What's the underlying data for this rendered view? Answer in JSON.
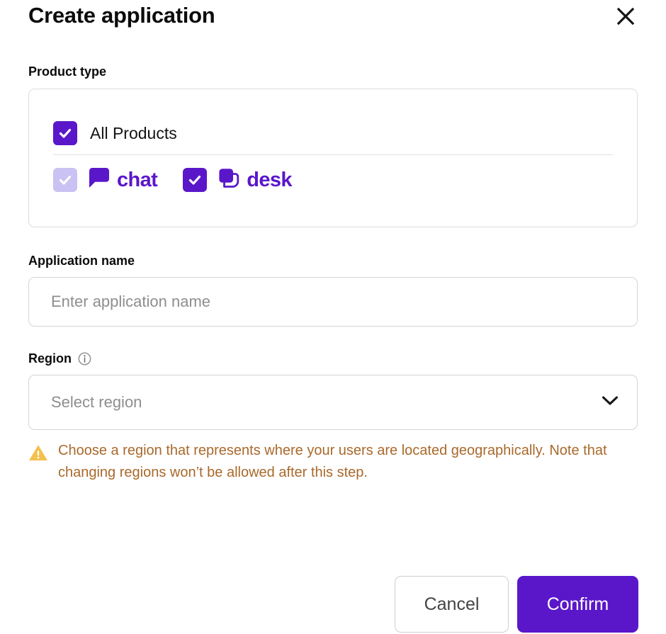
{
  "dialog": {
    "title": "Create application",
    "close_icon": "close-icon"
  },
  "product_type": {
    "label": "Product type",
    "all_products": {
      "label": "All Products",
      "checked": true,
      "checkbox_state": "checked"
    },
    "options": [
      {
        "id": "chat",
        "label": "chat",
        "icon": "chat-bubble-icon",
        "checked": true,
        "checkbox_state": "checked-muted"
      },
      {
        "id": "desk",
        "label": "desk",
        "icon": "desk-squares-icon",
        "checked": true,
        "checkbox_state": "checked"
      }
    ]
  },
  "application_name": {
    "label": "Application name",
    "value": "",
    "placeholder": "Enter application name"
  },
  "region": {
    "label": "Region",
    "info_icon": "info-circle-icon",
    "selected": "",
    "placeholder": "Select region",
    "chevron_icon": "chevron-down-icon",
    "warning_icon": "warning-triangle-icon",
    "warning_text": "Choose a region that represents where your users are located geographically. Note that changing regions won’t be allowed after this step."
  },
  "footer": {
    "cancel_label": "Cancel",
    "confirm_label": "Confirm"
  },
  "colors": {
    "brand_purple": "#5a17ca",
    "muted_purple": "#c9c2f2",
    "warning_amber": "#a9692b",
    "warning_icon_yellow": "#f3c14f",
    "border_gray": "#d5d5d5",
    "placeholder_gray": "#8e8e8e"
  }
}
